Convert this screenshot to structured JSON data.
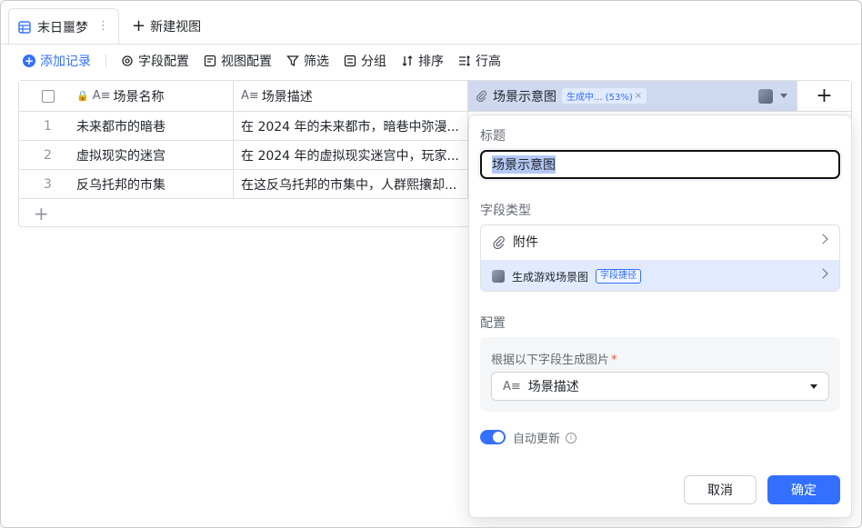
{
  "tabs": {
    "active_label": "末日噩梦",
    "new_view_label": "新建视图"
  },
  "toolbar": {
    "add_record": "添加记录",
    "field_config": "字段配置",
    "view_config": "视图配置",
    "filter": "筛选",
    "group": "分组",
    "sort": "排序",
    "row_height": "行高"
  },
  "table": {
    "columns": {
      "name": "场景名称",
      "desc": "场景描述",
      "image": "场景示意图",
      "image_status": "生成中... (53%)"
    },
    "rows": [
      {
        "idx": "1",
        "name": "未来都市的暗巷",
        "desc": "在 2024 年的未来都市，暗巷中弥漫..."
      },
      {
        "idx": "2",
        "name": "虚拟现实的迷宫",
        "desc": "在 2024 年的虚拟现实迷宫中，玩家..."
      },
      {
        "idx": "3",
        "name": "反乌托邦的市集",
        "desc": "在这反乌托邦的市集中，人群熙攘却..."
      }
    ]
  },
  "panel": {
    "title_label": "标题",
    "title_value": "场景示意图",
    "type_label": "字段类型",
    "type_attachment": "附件",
    "type_game_scene": "生成游戏场景图",
    "type_shortcut_tag": "字段捷径",
    "config_label": "配置",
    "config_source_label": "根据以下字段生成图片",
    "config_required_mark": "*",
    "config_source_value": "场景描述",
    "auto_update_label": "自动更新",
    "cancel": "取消",
    "confirm": "确定"
  },
  "colors": {
    "accent": "#3370ff",
    "header_selected": "#cfd9f0",
    "required": "#f54a45"
  }
}
